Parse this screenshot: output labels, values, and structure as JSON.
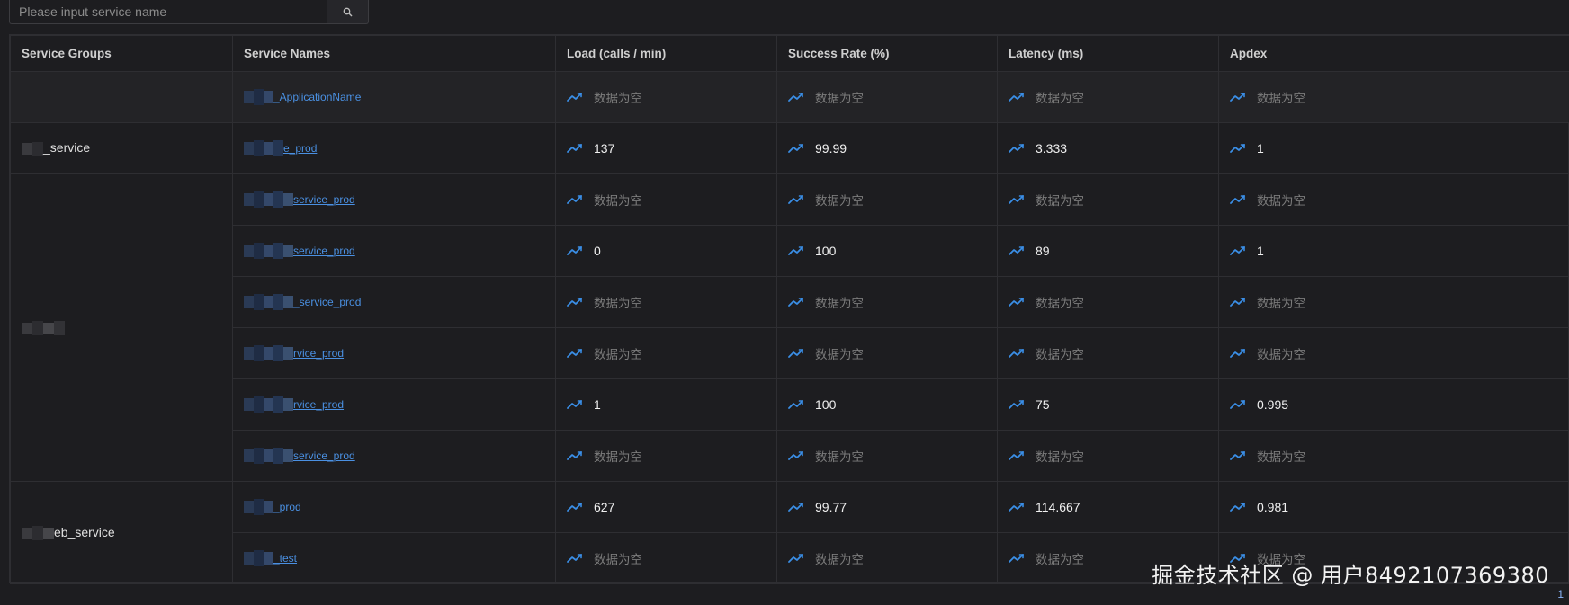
{
  "search": {
    "placeholder": "Please input service name"
  },
  "table": {
    "headers": {
      "groups": "Service Groups",
      "names": "Service Names",
      "load": "Load (calls / min)",
      "success": "Success Rate (%)",
      "latency": "Latency (ms)",
      "apdex": "Apdex"
    },
    "empty_text": "数据为空",
    "groups": [
      {
        "label": ""
      },
      {
        "label": "_service"
      },
      {
        "label": ""
      },
      {
        "label": "eb_service"
      }
    ],
    "rows": [
      {
        "name": "_ApplicationName",
        "load": "",
        "success": "",
        "latency": "",
        "apdex": ""
      },
      {
        "name": "e_prod",
        "load": "137",
        "success": "99.99",
        "latency": "3.333",
        "apdex": "1"
      },
      {
        "name": "service_prod",
        "load": "",
        "success": "",
        "latency": "",
        "apdex": ""
      },
      {
        "name": "service_prod",
        "load": "0",
        "success": "100",
        "latency": "89",
        "apdex": "1"
      },
      {
        "name": "_service_prod",
        "load": "",
        "success": "",
        "latency": "",
        "apdex": ""
      },
      {
        "name": "rvice_prod",
        "load": "",
        "success": "",
        "latency": "",
        "apdex": ""
      },
      {
        "name": "rvice_prod",
        "load": "1",
        "success": "100",
        "latency": "75",
        "apdex": "0.995"
      },
      {
        "name": "service_prod",
        "load": "",
        "success": "",
        "latency": "",
        "apdex": ""
      },
      {
        "name": "_prod",
        "load": "627",
        "success": "99.77",
        "latency": "114.667",
        "apdex": "0.981"
      },
      {
        "name": "_test",
        "load": "",
        "success": "",
        "latency": "",
        "apdex": ""
      }
    ]
  },
  "watermark": "掘金技术社区 @ 用户8492107369380",
  "pager": "1",
  "colors": {
    "background": "#1d1d20",
    "link": "#4a90e2",
    "trend_icon": "#3a8ee6"
  },
  "icons": {
    "search": "search-icon",
    "trend": "trend-line-icon"
  }
}
